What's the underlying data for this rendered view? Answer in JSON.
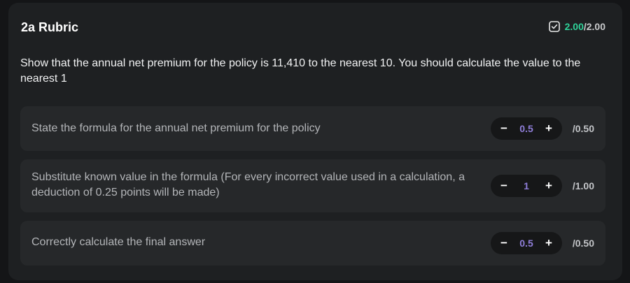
{
  "rubric": {
    "title": "2a Rubric",
    "score_earned": "2.00",
    "score_sep": "/",
    "score_max": "2.00",
    "score_color": "#2fd39a",
    "icon": "checkbox-icon"
  },
  "question": "Show that the annual net premium for the policy is 11,410 to the nearest 10. You should calculate the value to the nearest 1",
  "criteria": [
    {
      "label": "State the formula for the annual net premium for the policy",
      "value": "0.5",
      "max": "/0.50"
    },
    {
      "label": "Substitute known value in the formula (For every incorrect value used in a calculation, a deduction of 0.25 points will be made)",
      "value": "1",
      "max": "/1.00"
    },
    {
      "label": "Correctly calculate the final answer",
      "value": "0.5",
      "max": "/0.50"
    }
  ],
  "stepper": {
    "minus_label": "−",
    "plus_label": "+",
    "value_color": "#8f7ed9"
  }
}
